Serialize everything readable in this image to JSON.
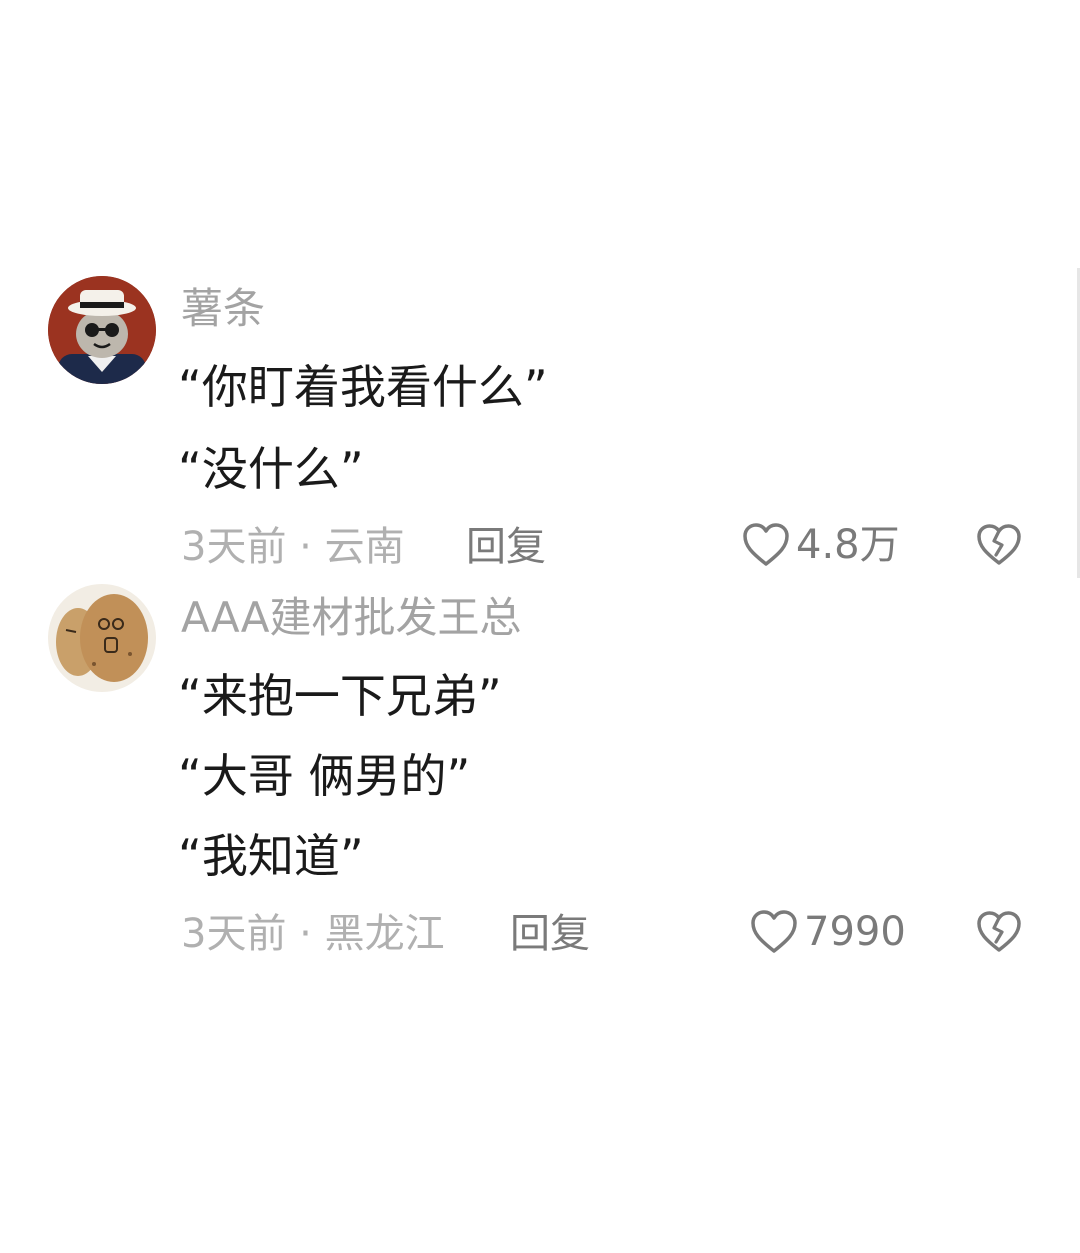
{
  "comments": [
    {
      "username": "薯条",
      "lines": [
        "“你盯着我看什么”",
        "“没什么”"
      ],
      "time_location": "3天前 · 云南",
      "reply_label": "回复",
      "likes": "4.8万",
      "avatar_icon": "cartoon-gangster-avatar",
      "like_icon": "heart-outline-icon",
      "dislike_icon": "broken-heart-icon"
    },
    {
      "username": "AAA建材批发王总",
      "lines": [
        "“来抱一下兄弟”",
        "“大哥 俩男的”",
        "“我知道”"
      ],
      "time_location": "3天前 · 黑龙江",
      "reply_label": "回复",
      "likes": "7990",
      "avatar_icon": "potato-meme-avatar",
      "like_icon": "heart-outline-icon",
      "dislike_icon": "broken-heart-icon"
    }
  ],
  "colors": {
    "username": "#a3a3a3",
    "text": "#1a1a1a",
    "meta": "#b0b0b0",
    "action": "#7a7a7a"
  }
}
